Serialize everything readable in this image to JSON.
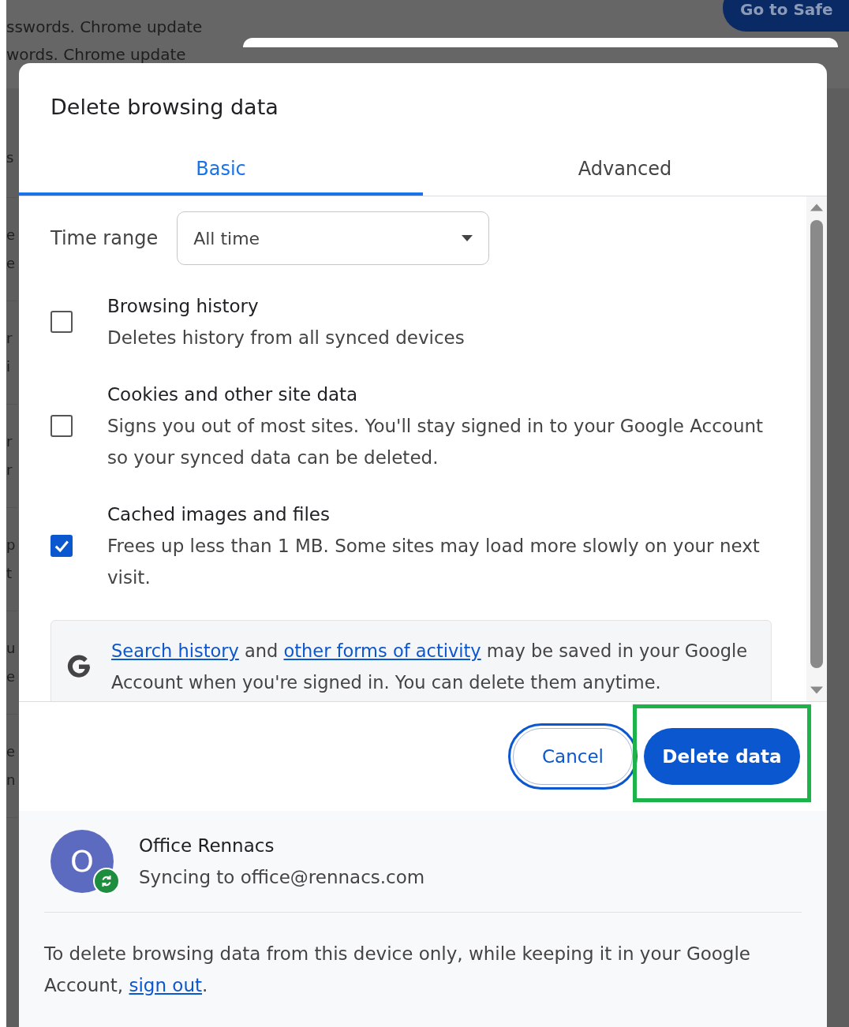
{
  "background": {
    "lines": [
      "sswords. Chrome update",
      "words. Chrome update"
    ],
    "button": "Go to Safe",
    "edge_rows": [
      [
        "s"
      ],
      [
        "e",
        "e"
      ],
      [
        "r",
        "i"
      ],
      [
        "r",
        "r"
      ],
      [
        "p",
        "t"
      ],
      [
        "u",
        "e"
      ],
      [
        "e",
        "n"
      ]
    ]
  },
  "dialog": {
    "title": "Delete browsing data",
    "tabs": [
      {
        "label": "Basic",
        "selected": true
      },
      {
        "label": "Advanced",
        "selected": false
      }
    ],
    "time_range": {
      "label": "Time range",
      "value": "All time"
    },
    "options": [
      {
        "title": "Browsing history",
        "description": "Deletes history from all synced devices",
        "checked": false
      },
      {
        "title": "Cookies and other site data",
        "description": "Signs you out of most sites. You'll stay signed in to your Google Account so your synced data can be deleted.",
        "checked": false
      },
      {
        "title": "Cached images and files",
        "description": "Frees up less than 1 MB. Some sites may load more slowly on your next visit.",
        "checked": true
      }
    ],
    "notice": [
      {
        "kind": "link",
        "text": "Search history"
      },
      {
        "kind": "text",
        "text": " and "
      },
      {
        "kind": "link",
        "text": "other forms of activity"
      },
      {
        "kind": "text",
        "text": " may be saved in your Google Account when you're signed in. You can delete them anytime."
      }
    ],
    "buttons": [
      {
        "label": "Cancel",
        "kind": "outline",
        "focused": true,
        "highlighted": false
      },
      {
        "label": "Delete data",
        "kind": "primary",
        "focused": false,
        "highlighted": true
      }
    ],
    "account": {
      "initial": "O",
      "name": "Office Rennacs",
      "status": "Syncing to office@rennacs.com"
    },
    "footer": [
      {
        "kind": "text",
        "text": "To delete browsing data from this device only, while keeping it in your Google Account, "
      },
      {
        "kind": "link",
        "text": "sign out"
      },
      {
        "kind": "text",
        "text": "."
      }
    ]
  }
}
